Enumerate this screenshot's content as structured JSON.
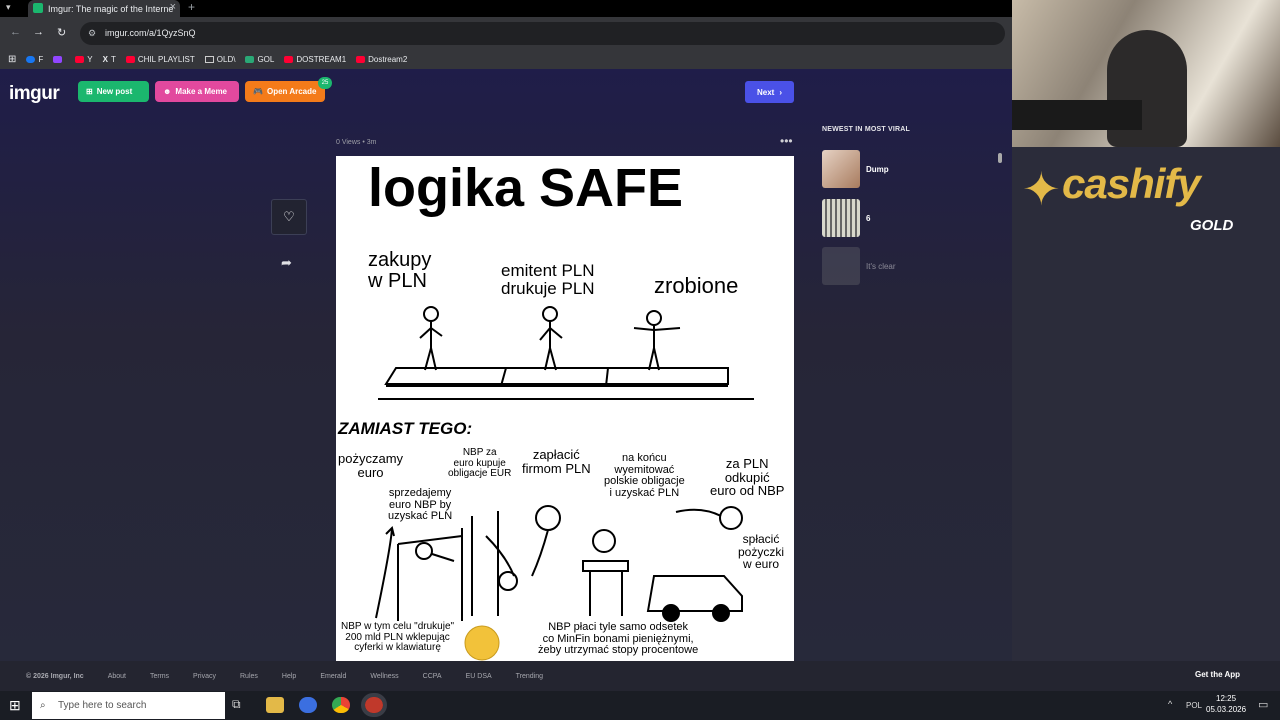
{
  "browser": {
    "tab_title": "Imgur: The magic of the Interne",
    "url": "imgur.com/a/1QyzSnQ",
    "bookmarks": [
      "F",
      "",
      "Y",
      "T",
      "CHIL PLAYLIST",
      "OLD\\",
      "GOL",
      "DOSTREAM1",
      "Dostream2"
    ]
  },
  "header": {
    "logo": "imgur",
    "new_post": "New post",
    "make_meme": "Make a Meme",
    "open_arcade": "Open Arcade",
    "arcade_badge": "25",
    "next": "Next"
  },
  "post": {
    "meta": "0 Views • 3m"
  },
  "meme": {
    "title": "logika SAFE",
    "zakupy": "zakupy\nw PLN",
    "emitent": "emitent PLN\ndrukuje PLN",
    "zrobione": "zrobione",
    "zamiast": "ZAMIAST TEGO:",
    "pozyczamy": "pożyczamy\neuro",
    "nbp_za": "NBP za\neuro kupuje\nobligacje EUR",
    "zaplacic": "zapłacić\nfirmom PLN",
    "na_koncu": "na końcu\nwyemitować\npolskie obligacje\ni uzyskać PLN",
    "za_pln": "za PLN\nodkupić\neuro od NBP",
    "sprzedajemy": "sprzedajemy\neuro NBP by\nuzyskać PLN",
    "splacic": "spłacić\npożyczki\nw euro",
    "nbp_drukuje": "NBP w tym celu \"drukuje\"\n200 mld PLN wklepując\ncyferki w klawiaturę",
    "nbp_placi": "NBP płaci tyle samo odsetek\nco MinFin bonami pieniężnymi,\nżeby utrzymać stopy procentowe"
  },
  "sidebar": {
    "heading": "NEWEST IN MOST VIRAL",
    "items": [
      {
        "title": "Dump",
        "color": "#c9a58a"
      },
      {
        "title": "6",
        "color": "#9aa08c"
      },
      {
        "title": "It's clear",
        "color": "#5d5e66"
      }
    ]
  },
  "footer": {
    "links": [
      "© 2026 Imgur, Inc",
      "About",
      "Terms",
      "Privacy",
      "Rules",
      "Help",
      "Emerald",
      "Wellness",
      "CCPA",
      "EU DSA",
      "Trending"
    ],
    "get_app": "Get the App"
  },
  "taskbar": {
    "search_placeholder": "Type here to search",
    "lang": "POL",
    "time": "12:25",
    "date": "05.03.2026"
  },
  "overlay": {
    "brand": "cashify",
    "sub": "GOLD"
  }
}
